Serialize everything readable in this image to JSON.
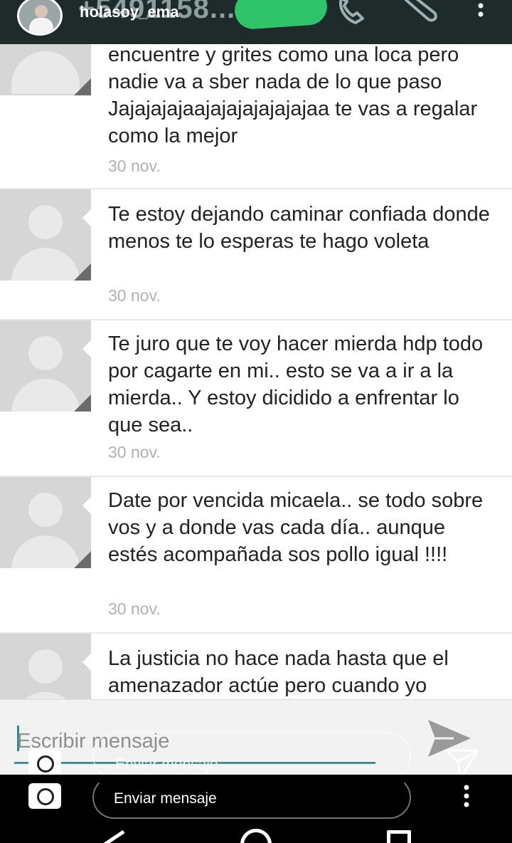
{
  "header": {
    "phone_number": "+5491158...",
    "instagram_username": "holasoy_ema",
    "icons": [
      "phone-icon",
      "paperclip-icon",
      "overflow-menu-icon"
    ]
  },
  "messages": [
    {
      "text": "encuentre y grites como una loca pero nadie va a sber nada de lo que paso Jajajajajaajajajajajajajaa te vas a regalar como la mejor",
      "date": "30 nov."
    },
    {
      "text": "Te estoy dejando caminar confiada donde menos te lo esperas te hago voleta",
      "date": "30 nov."
    },
    {
      "text": "Te juro que te voy hacer mierda hdp todo por cagarte en mi.. esto se va a ir a la mierda.. Y estoy dicidido a enfrentar lo que sea..",
      "date": "30 nov."
    },
    {
      "text": "Date por vencida micaela.. se todo sobre vos y a donde vas cada día.. aunque estés acompañada sos pollo igual !!!!",
      "date": "30 nov."
    },
    {
      "text": "La justicia no hace nada hasta que el amenazador actúe pero cuando yo",
      "date": ""
    }
  ],
  "compose": {
    "placeholder": "Escribir mensaje"
  },
  "story_overlay": {
    "reply_label": "Enviar mensaje",
    "reply_label_2": "Enviar mensaje"
  },
  "colors": {
    "header_bg": "#1f2a2a",
    "accent": "#1d8f8f",
    "scribble": "#2ec46a"
  }
}
